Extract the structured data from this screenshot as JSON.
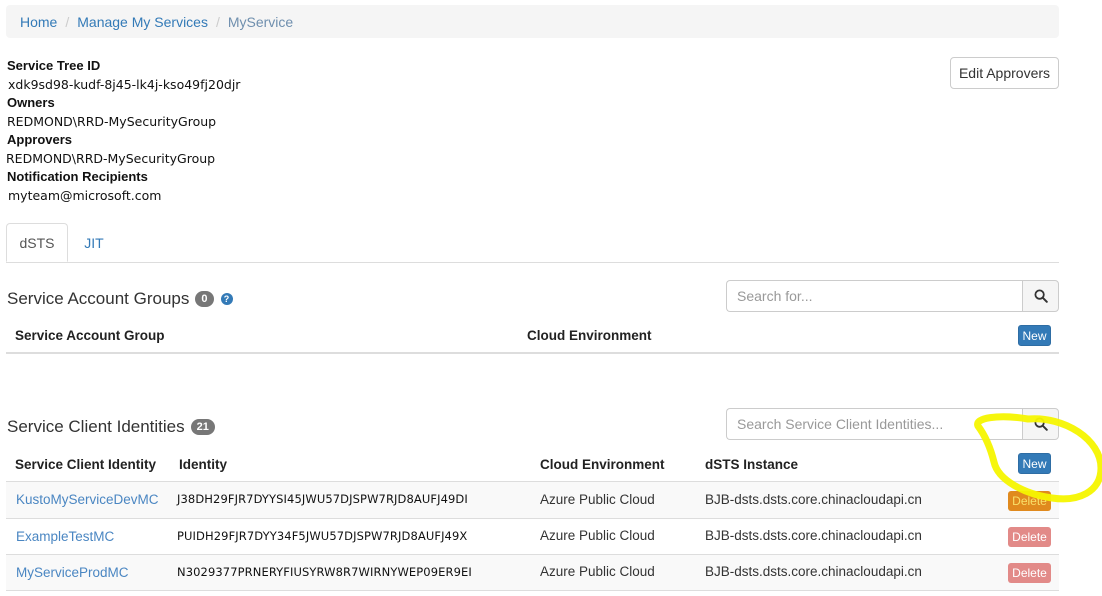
{
  "breadcrumb": {
    "home": "Home",
    "manage": "Manage My Services",
    "current": "MyService",
    "separator": "/"
  },
  "details": {
    "service_tree_id_label": "Service Tree ID",
    "service_tree_id": "xdk9sd98-kudf-8j45-lk4j-kso49fj20djr",
    "owners_label": "Owners",
    "owners": "REDMOND\\RRD-MySecurityGroup",
    "approvers_label": "Approvers",
    "approvers": "REDMOND\\RRD-MySecurityGroup",
    "notification_label": "Notification Recipients",
    "notification": "myteam@microsoft.com"
  },
  "edit_approvers_label": "Edit Approvers",
  "tabs": [
    {
      "label": "dSTS",
      "active": true
    },
    {
      "label": "JIT",
      "active": false
    }
  ],
  "service_account_groups": {
    "title": "Service Account Groups",
    "count": "0",
    "help_icon": "question-circle-icon",
    "search_placeholder": "Search for...",
    "columns": [
      "Service Account Group",
      "Cloud Environment"
    ],
    "new_label": "New"
  },
  "service_client_identities": {
    "title": "Service Client Identities",
    "count": "21",
    "search_placeholder": "Search Service Client Identities...",
    "columns": [
      "Service Client Identity",
      "Identity",
      "Cloud Environment",
      "dSTS Instance"
    ],
    "new_label": "New",
    "delete_label": "Delete",
    "rows": [
      {
        "name": "KustoMyServiceDevMC",
        "identity": "J38DH29FJR7DYYSI45JWU57DJSPW7RJD8AUFJ49DI",
        "cloud": "Azure Public Cloud",
        "instance": "BJB-dsts.dsts.core.chinacloudapi.cn"
      },
      {
        "name": "ExampleTestMC",
        "identity": "PUIDH29FJR7DYY34F5JWU57DJSPW7RJD8AUFJ49X",
        "cloud": "Azure Public Cloud",
        "instance": "BJB-dsts.dsts.core.chinacloudapi.cn"
      },
      {
        "name": "MyServiceProdMC",
        "identity": "N3029377PRNERYFIUSYRW8R7WIRNYWEP09ER9EI",
        "cloud": "Azure Public Cloud",
        "instance": "BJB-dsts.dsts.core.chinacloudapi.cn"
      }
    ]
  },
  "colors": {
    "link": "#337ab7",
    "primary": "#337ab7",
    "danger_light": "#e28a88",
    "badge": "#777777",
    "annotation_yellow": "#f5f500"
  }
}
